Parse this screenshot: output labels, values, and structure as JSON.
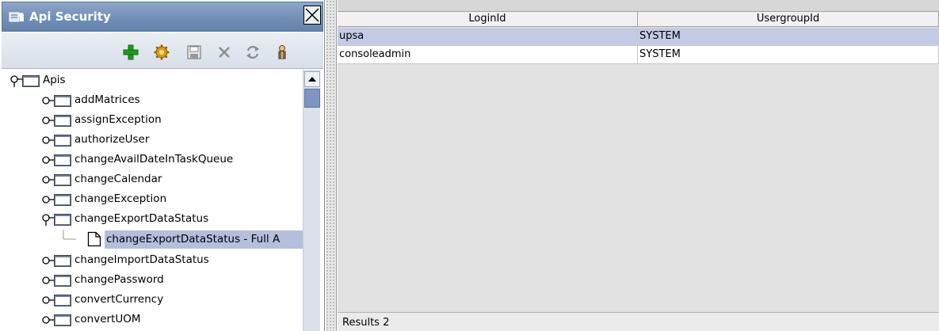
{
  "panel": {
    "title": "Api Security",
    "toolbar_icons": [
      "add-icon",
      "settings-gear-icon",
      "save-icon",
      "delete-icon",
      "refresh-icon",
      "user-icon"
    ]
  },
  "tree": {
    "root": "Apis",
    "items": [
      {
        "label": "addMatrices",
        "expanded": false
      },
      {
        "label": "assignException",
        "expanded": false
      },
      {
        "label": "authorizeUser",
        "expanded": false
      },
      {
        "label": "changeAvailDateInTaskQueue",
        "expanded": false
      },
      {
        "label": "changeCalendar",
        "expanded": false
      },
      {
        "label": "changeException",
        "expanded": false
      },
      {
        "label": "changeExportDataStatus",
        "expanded": true
      },
      {
        "label": "changeExportDataStatus - Full A",
        "child": true,
        "selected": true
      },
      {
        "label": "changeImportDataStatus",
        "expanded": false
      },
      {
        "label": "changePassword",
        "expanded": false
      },
      {
        "label": "convertCurrency",
        "expanded": false
      },
      {
        "label": "convertUOM",
        "expanded": false
      }
    ]
  },
  "table": {
    "columns": [
      "LoginId",
      "UsergroupId"
    ],
    "rows": [
      [
        "upsa",
        "SYSTEM"
      ],
      [
        "consoleadmin",
        "SYSTEM"
      ]
    ]
  },
  "status": {
    "results_text": "Results 2"
  },
  "colors": {
    "title_bar": "#7693b9",
    "selection": "#b4bfdd",
    "add_green": "#1f9a1f"
  }
}
